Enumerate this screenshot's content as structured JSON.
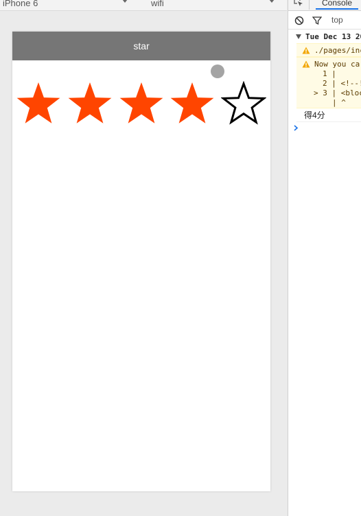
{
  "simulator": {
    "device": "iPhone 6",
    "network": "wifi"
  },
  "page": {
    "nav_title": "star",
    "rating": {
      "score": 4,
      "max": 5
    },
    "colors": {
      "filled_star": "#ff4500",
      "empty_star_outline": "#000000",
      "nav_bar": "#767676"
    }
  },
  "devtools": {
    "tab": "Console",
    "context": "top",
    "group_header": "Tue Dec 13 20",
    "warnings": [
      {
        "text": "./pages/inc"
      },
      {
        "text": "Now you ca",
        "code_lines": [
          "1 |",
          "2 | <!--!",
          "> 3 | <bloc",
          "|  ^"
        ]
      }
    ],
    "log_output": "得4分",
    "icons": [
      "inspect-icon",
      "clear-console-icon",
      "filter-icon",
      "warning-icon",
      "prompt-chevron-icon"
    ]
  }
}
